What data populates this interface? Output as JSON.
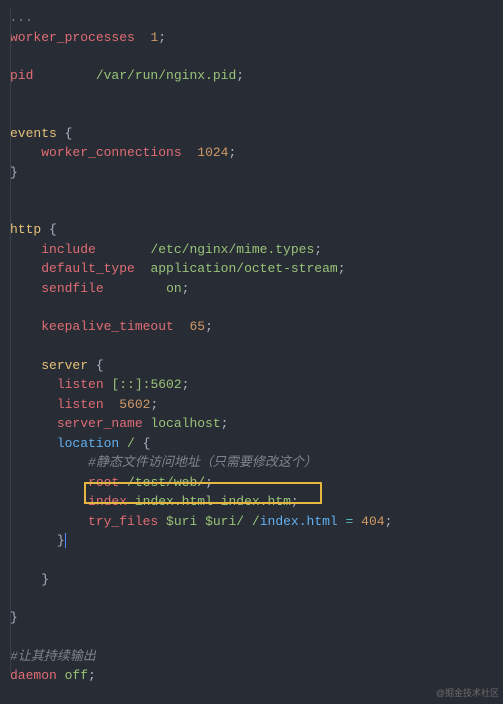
{
  "code": {
    "l1": "...",
    "l2_key": "worker_processes",
    "l2_val": "1",
    "l4_key": "pid",
    "l4_val": "/var/run/nginx.pid",
    "l7_key": "events",
    "l8_key": "worker_connections",
    "l8_val": "1024",
    "l12_key": "http",
    "l13_key": "include",
    "l13_val": "/etc/nginx/mime.types",
    "l14_key": "default_type",
    "l14_val": "application/octet-stream",
    "l15_key": "sendfile",
    "l15_val": "on",
    "l17_key": "keepalive_timeout",
    "l17_val": "65",
    "l19_key": "server",
    "l20_key": "listen",
    "l20_val": "[::]:5602",
    "l21_key": "listen",
    "l21_val": "5602",
    "l22_key": "server_name",
    "l22_val": "localhost",
    "l23_key": "location",
    "l23_path": "/",
    "l24_comment": "#静态文件访问地址（只需要修改这个）",
    "l25_key": "root",
    "l25_val": "/test/web/",
    "l26_key": "index",
    "l26_val1": "index.html",
    "l26_val2": "index.htm",
    "l27_key": "try_files",
    "l27_v1": "$uri",
    "l27_v2": "$uri/",
    "l27_v3": "/",
    "l27_v4": "index.html",
    "l27_eq": "=",
    "l27_code": "404",
    "l33_comment": "#让其持续输出",
    "l34_key": "daemon",
    "l34_val": "off",
    "semi": ";",
    "lbrace": "{",
    "rbrace": "}"
  },
  "watermark": "@掘金技术社区"
}
